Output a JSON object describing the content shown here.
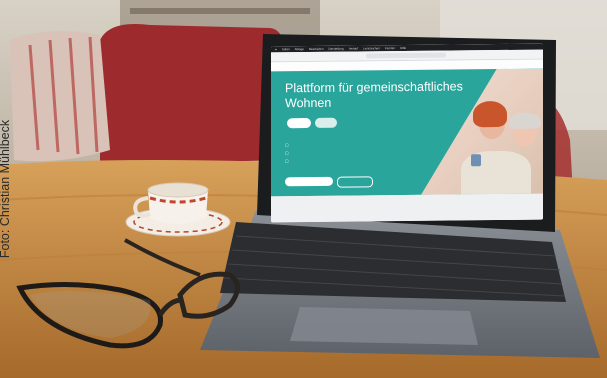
{
  "credit": "Foto: Christian Mühlbeck",
  "screen": {
    "menu": [
      "Safari",
      "Ablage",
      "Bearbeiten",
      "Darstellung",
      "Verlauf",
      "Lesezeichen",
      "Fenster",
      "Hilfe"
    ],
    "title": "Plattform für gemeinschaftliches Wohnen",
    "pills": [
      "",
      ""
    ],
    "features": [
      "",
      "",
      ""
    ],
    "buttons": [
      "",
      ""
    ]
  },
  "colors": {
    "accent": "#2aa59c",
    "table": "#c98b3e",
    "laptop": "#7d8289"
  }
}
